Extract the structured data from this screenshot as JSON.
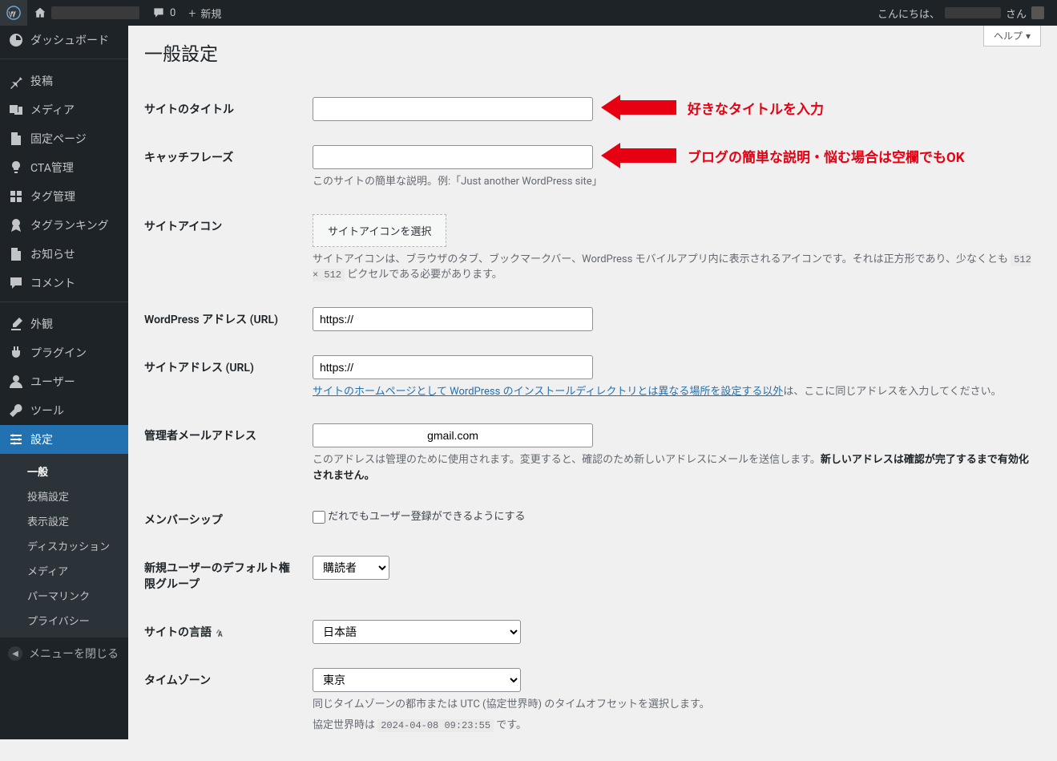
{
  "adminbar": {
    "comment_count": "0",
    "new_label": "新規",
    "greeting_prefix": "こんにちは、",
    "greeting_suffix": "さん"
  },
  "sidebar": {
    "items": [
      {
        "label": "ダッシュボード",
        "icon": "dashboard"
      },
      {
        "sep": true
      },
      {
        "label": "投稿",
        "icon": "pin"
      },
      {
        "label": "メディア",
        "icon": "media"
      },
      {
        "label": "固定ページ",
        "icon": "page"
      },
      {
        "label": "CTA管理",
        "icon": "bulb"
      },
      {
        "label": "タグ管理",
        "icon": "grid"
      },
      {
        "label": "タグランキング",
        "icon": "award"
      },
      {
        "label": "お知らせ",
        "icon": "page"
      },
      {
        "label": "コメント",
        "icon": "comment"
      },
      {
        "sep": true
      },
      {
        "label": "外観",
        "icon": "brush"
      },
      {
        "label": "プラグイン",
        "icon": "plug"
      },
      {
        "label": "ユーザー",
        "icon": "user"
      },
      {
        "label": "ツール",
        "icon": "tool"
      },
      {
        "label": "設定",
        "icon": "settings",
        "current": true
      }
    ],
    "submenu": [
      "一般",
      "投稿設定",
      "表示設定",
      "ディスカッション",
      "メディア",
      "パーマリンク",
      "プライバシー"
    ],
    "submenu_current": "一般",
    "collapse_label": "メニューを閉じる"
  },
  "page": {
    "help_label": "ヘルプ",
    "title": "一般設定",
    "annotations": {
      "title_arrow": "好きなタイトルを入力",
      "tagline_arrow": "ブログの簡単な説明・悩む場合は空欄でもOK"
    },
    "fields": {
      "site_title": {
        "label": "サイトのタイトル",
        "value": ""
      },
      "tagline": {
        "label": "キャッチフレーズ",
        "value": "",
        "desc": "このサイトの簡単な説明。例:「Just another WordPress site」"
      },
      "site_icon": {
        "label": "サイトアイコン",
        "button": "サイトアイコンを選択",
        "desc_pre": "サイトアイコンは、ブラウザのタブ、ブックマークバー、WordPress モバイルアプリ内に表示されるアイコンです。それは正方形であり、少なくとも ",
        "desc_code": "512 × 512",
        "desc_post": " ピクセルである必要があります。"
      },
      "wp_url": {
        "label": "WordPress アドレス (URL)",
        "value": "https://"
      },
      "site_url": {
        "label": "サイトアドレス (URL)",
        "value": "https://",
        "link": "サイトのホームページとして WordPress のインストールディレクトリとは異なる場所を設定する以外",
        "desc_post": "は、ここに同じアドレスを入力してください。"
      },
      "admin_email": {
        "label": "管理者メールアドレス",
        "value_display": "gmail.com",
        "desc_pre": "このアドレスは管理のために使用されます。変更すると、確認のため新しいアドレスにメールを送信します。",
        "desc_strong": "新しいアドレスは確認が完了するまで有効化されません。"
      },
      "membership": {
        "label": "メンバーシップ",
        "checkbox_label": "だれでもユーザー登録ができるようにする"
      },
      "default_role": {
        "label": "新規ユーザーのデフォルト権限グループ",
        "value": "購読者"
      },
      "language": {
        "label": "サイトの言語",
        "value": "日本語"
      },
      "timezone": {
        "label": "タイムゾーン",
        "value": "東京",
        "desc": "同じタイムゾーンの都市または UTC (協定世界時) のタイムオフセットを選択します。",
        "utc_pre": "協定世界時は ",
        "utc_code": "2024-04-08 09:23:55",
        "utc_post": " です。"
      }
    }
  }
}
